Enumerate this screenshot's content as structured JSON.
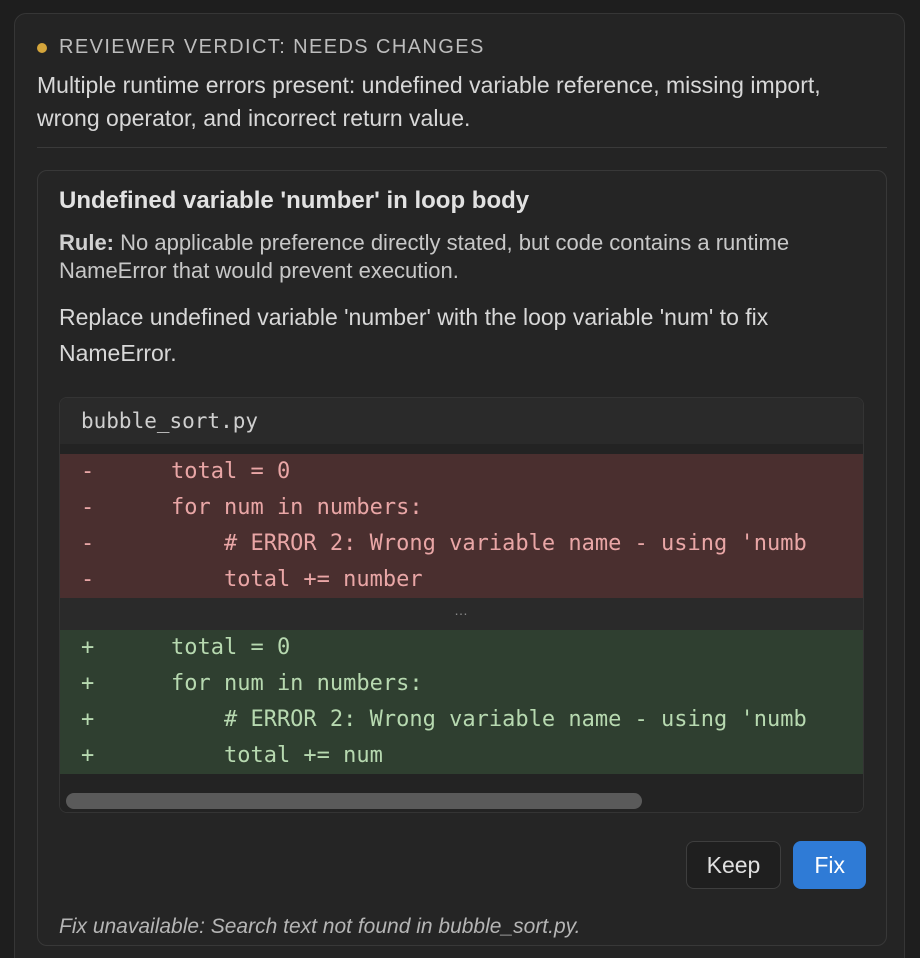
{
  "verdict": {
    "title": "REVIEWER VERDICT: NEEDS CHANGES",
    "summary": "Multiple runtime errors present: undefined variable reference, missing import, wrong operator, and incorrect return value.",
    "status_color": "#d4a53b"
  },
  "issue": {
    "title": "Undefined variable 'number' in loop body",
    "rule_label": "Rule:",
    "rule_text": " No applicable preference directly stated, but code contains a runtime NameError that would prevent execution.",
    "description": "Replace undefined variable 'number' with the loop variable 'num' to fix NameError.",
    "diff": {
      "filename": "bubble_sort.py",
      "removed": [
        {
          "sign": "-",
          "code": "    total = 0"
        },
        {
          "sign": "-",
          "code": "    for num in numbers:"
        },
        {
          "sign": "-",
          "code": "        # ERROR 2: Wrong variable name - using 'numb"
        },
        {
          "sign": "-",
          "code": "        total += number"
        }
      ],
      "separator": "…",
      "added": [
        {
          "sign": "+",
          "code": "    total = 0"
        },
        {
          "sign": "+",
          "code": "    for num in numbers:"
        },
        {
          "sign": "+",
          "code": "        # ERROR 2: Wrong variable name - using 'numb"
        },
        {
          "sign": "+",
          "code": "        total += num"
        }
      ]
    },
    "actions": {
      "keep_label": "Keep",
      "fix_label": "Fix"
    },
    "fix_note": "Fix unavailable: Search text not found in bubble_sort.py."
  },
  "colors": {
    "accent": "#2f7bd6",
    "removed_bg": "#4a2f2f",
    "added_bg": "#2f3f30"
  }
}
